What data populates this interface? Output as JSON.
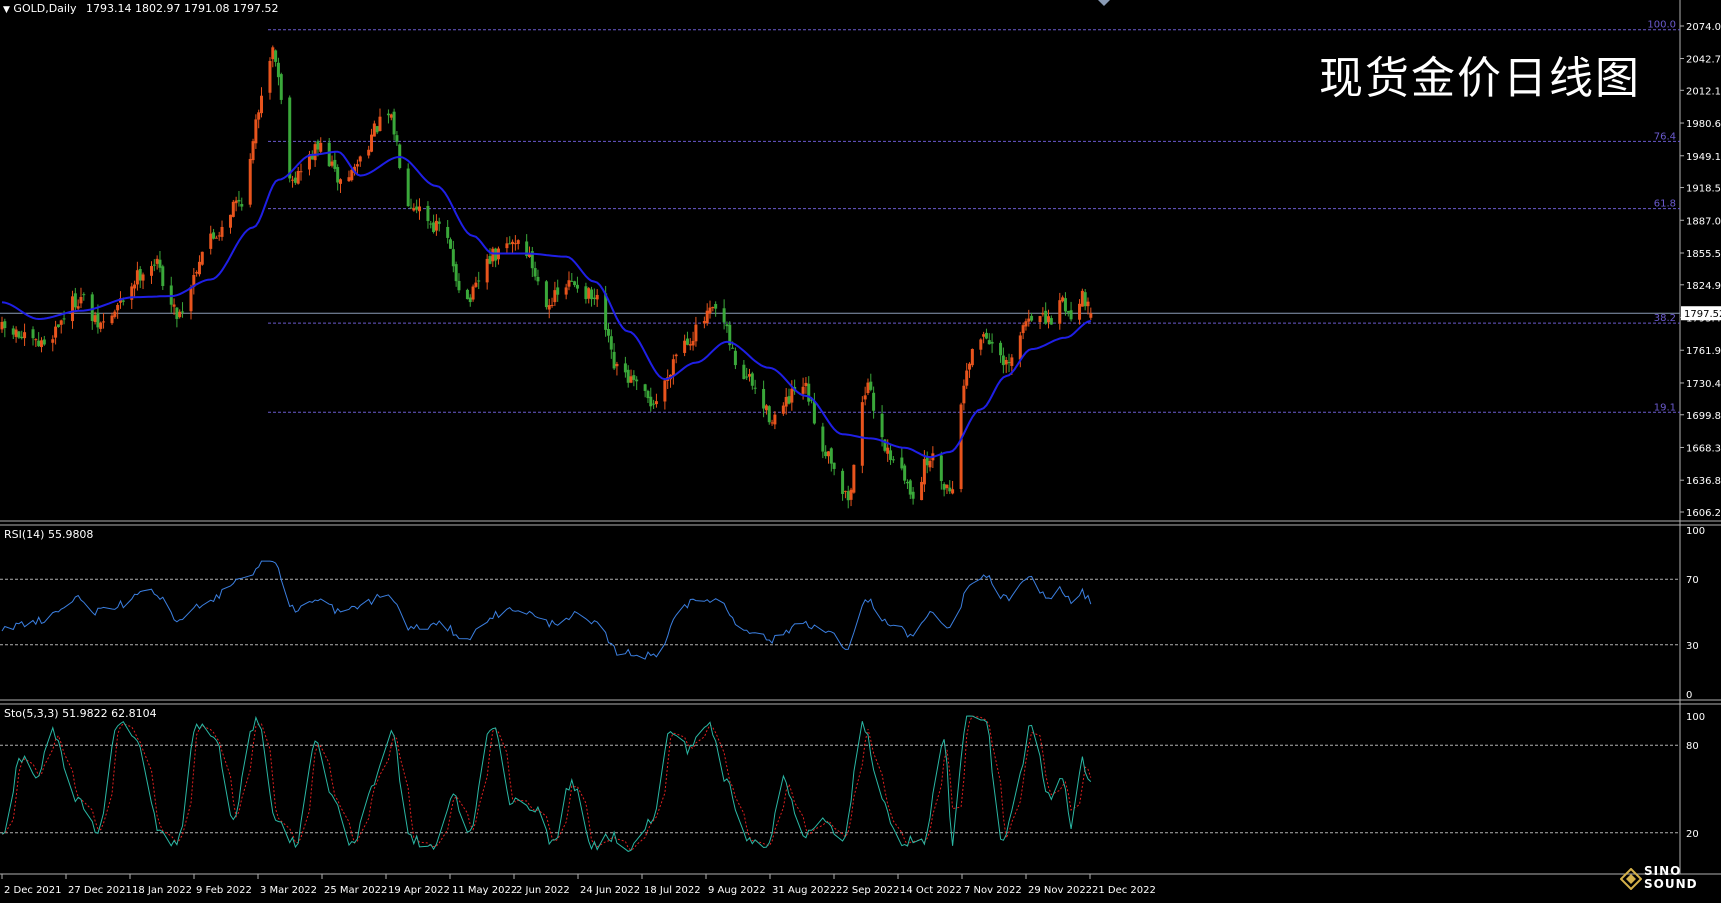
{
  "window": {
    "symbol_label": "GOLD,Daily",
    "ohlc": "1793.14 1802.97 1791.08 1797.52",
    "dropdown_icon": "triangle-down-icon"
  },
  "overlay_title": "现货金价日线图",
  "colors": {
    "background": "#000000",
    "bull": "#e8541d",
    "bear": "#3aa83a",
    "ma": "#1f1fe6",
    "rsi": "#3b7fe0",
    "stoch_main": "#2ab7a4",
    "stoch_signal": "#e02020",
    "fib": "#6a5acd",
    "grid": "#b0b0b0",
    "price_line": "#8a9bb5",
    "axis_text": "#ffffff"
  },
  "chart_data": [
    {
      "type": "candlestick",
      "title": "GOLD,Daily",
      "symbol": "GOLD",
      "timeframe": "Daily",
      "ohlc_last": {
        "open": 1793.14,
        "high": 1802.97,
        "low": 1791.08,
        "close": 1797.52
      },
      "ylim": [
        1606.2,
        2074.0
      ],
      "y_ticks": [
        "2074.00",
        "2042.70",
        "2012.10",
        "1980.60",
        "1949.10",
        "1918.50",
        "1887.00",
        "1855.50",
        "1824.90",
        "1793.40",
        "1761.90",
        "1730.40",
        "1699.80",
        "1668.30",
        "1636.80",
        "1606.20"
      ],
      "current_price_label": "1797.52",
      "x_ticks": [
        "2 Dec 2021",
        "27 Dec 2021",
        "18 Jan 2022",
        "9 Feb 2022",
        "3 Mar 2022",
        "25 Mar 2022",
        "19 Apr 2022",
        "11 May 2022",
        "2 Jun 2022",
        "24 Jun 2022",
        "18 Jul 2022",
        "9 Aug 2022",
        "31 Aug 2022",
        "22 Sep 2022",
        "14 Oct 2022",
        "7 Nov 2022",
        "29 Nov 2022",
        "21 Dec 2022"
      ],
      "fibonacci": [
        {
          "label": "100.0",
          "price": 2070.4
        },
        {
          "label": "76.4",
          "price": 1963.0
        },
        {
          "label": "61.8",
          "price": 1898.2
        },
        {
          "label": "38.2",
          "price": 1788.0
        },
        {
          "label": "19.1",
          "price": 1702.2
        }
      ],
      "moving_average_anchors": [
        {
          "date": "2021-12-02",
          "value": 1808
        },
        {
          "date": "2021-12-15",
          "value": 1792
        },
        {
          "date": "2021-12-30",
          "value": 1800
        },
        {
          "date": "2022-01-18",
          "value": 1813
        },
        {
          "date": "2022-01-31",
          "value": 1814
        },
        {
          "date": "2022-02-14",
          "value": 1830
        },
        {
          "date": "2022-03-01",
          "value": 1880
        },
        {
          "date": "2022-03-10",
          "value": 1926
        },
        {
          "date": "2022-03-22",
          "value": 1950
        },
        {
          "date": "2022-03-31",
          "value": 1953
        },
        {
          "date": "2022-04-08",
          "value": 1930
        },
        {
          "date": "2022-04-22",
          "value": 1948
        },
        {
          "date": "2022-05-05",
          "value": 1920
        },
        {
          "date": "2022-05-18",
          "value": 1872
        },
        {
          "date": "2022-05-25",
          "value": 1855
        },
        {
          "date": "2022-06-06",
          "value": 1855
        },
        {
          "date": "2022-06-20",
          "value": 1852
        },
        {
          "date": "2022-06-30",
          "value": 1828
        },
        {
          "date": "2022-07-12",
          "value": 1780
        },
        {
          "date": "2022-07-25",
          "value": 1734
        },
        {
          "date": "2022-08-05",
          "value": 1750
        },
        {
          "date": "2022-08-16",
          "value": 1770
        },
        {
          "date": "2022-08-31",
          "value": 1745
        },
        {
          "date": "2022-09-13",
          "value": 1718
        },
        {
          "date": "2022-09-26",
          "value": 1681
        },
        {
          "date": "2022-10-06",
          "value": 1677
        },
        {
          "date": "2022-10-18",
          "value": 1668
        },
        {
          "date": "2022-10-27",
          "value": 1659
        },
        {
          "date": "2022-11-03",
          "value": 1664
        },
        {
          "date": "2022-11-14",
          "value": 1705
        },
        {
          "date": "2022-11-23",
          "value": 1737
        },
        {
          "date": "2022-12-02",
          "value": 1763
        },
        {
          "date": "2022-12-14",
          "value": 1774
        },
        {
          "date": "2022-12-23",
          "value": 1790
        }
      ],
      "close_anchors": [
        {
          "date": "2021-12-02",
          "value": 1782
        },
        {
          "date": "2021-12-15",
          "value": 1767
        },
        {
          "date": "2021-12-30",
          "value": 1812
        },
        {
          "date": "2022-01-05",
          "value": 1786
        },
        {
          "date": "2022-01-25",
          "value": 1846
        },
        {
          "date": "2022-02-02",
          "value": 1798
        },
        {
          "date": "2022-02-14",
          "value": 1870
        },
        {
          "date": "2022-02-24",
          "value": 1905
        },
        {
          "date": "2022-03-08",
          "value": 2050
        },
        {
          "date": "2022-03-15",
          "value": 1928
        },
        {
          "date": "2022-03-25",
          "value": 1957
        },
        {
          "date": "2022-04-01",
          "value": 1925
        },
        {
          "date": "2022-04-18",
          "value": 1985
        },
        {
          "date": "2022-04-26",
          "value": 1905
        },
        {
          "date": "2022-05-06",
          "value": 1880
        },
        {
          "date": "2022-05-16",
          "value": 1810
        },
        {
          "date": "2022-05-25",
          "value": 1852
        },
        {
          "date": "2022-06-03",
          "value": 1868
        },
        {
          "date": "2022-06-14",
          "value": 1810
        },
        {
          "date": "2022-06-23",
          "value": 1827
        },
        {
          "date": "2022-07-01",
          "value": 1808
        },
        {
          "date": "2022-07-08",
          "value": 1742
        },
        {
          "date": "2022-07-21",
          "value": 1712
        },
        {
          "date": "2022-08-01",
          "value": 1772
        },
        {
          "date": "2022-08-12",
          "value": 1799
        },
        {
          "date": "2022-08-22",
          "value": 1737
        },
        {
          "date": "2022-09-01",
          "value": 1698
        },
        {
          "date": "2022-09-12",
          "value": 1725
        },
        {
          "date": "2022-09-20",
          "value": 1666
        },
        {
          "date": "2022-09-28",
          "value": 1620
        },
        {
          "date": "2022-10-04",
          "value": 1725
        },
        {
          "date": "2022-10-13",
          "value": 1662
        },
        {
          "date": "2022-10-21",
          "value": 1625
        },
        {
          "date": "2022-10-27",
          "value": 1658
        },
        {
          "date": "2022-11-03",
          "value": 1629
        },
        {
          "date": "2022-11-10",
          "value": 1755
        },
        {
          "date": "2022-11-15",
          "value": 1778
        },
        {
          "date": "2022-11-23",
          "value": 1745
        },
        {
          "date": "2022-12-02",
          "value": 1797
        },
        {
          "date": "2022-12-08",
          "value": 1788
        },
        {
          "date": "2022-12-13",
          "value": 1810
        },
        {
          "date": "2022-12-16",
          "value": 1793
        },
        {
          "date": "2022-12-20",
          "value": 1817
        },
        {
          "date": "2022-12-23",
          "value": 1797.52
        }
      ]
    },
    {
      "type": "line",
      "title": "RSI(14) 55.9808",
      "ylim": [
        0,
        100
      ],
      "y_ticks": [
        "100",
        "70",
        "30",
        "0"
      ],
      "levels": [
        70,
        30
      ],
      "anchors": [
        {
          "date": "2021-12-02",
          "value": 40
        },
        {
          "date": "2021-12-15",
          "value": 45
        },
        {
          "date": "2021-12-30",
          "value": 58
        },
        {
          "date": "2022-01-05",
          "value": 50
        },
        {
          "date": "2022-01-25",
          "value": 62
        },
        {
          "date": "2022-02-02",
          "value": 45
        },
        {
          "date": "2022-02-14",
          "value": 58
        },
        {
          "date": "2022-02-24",
          "value": 70
        },
        {
          "date": "2022-03-08",
          "value": 82
        },
        {
          "date": "2022-03-15",
          "value": 52
        },
        {
          "date": "2022-03-25",
          "value": 57
        },
        {
          "date": "2022-04-01",
          "value": 50
        },
        {
          "date": "2022-04-18",
          "value": 60
        },
        {
          "date": "2022-04-26",
          "value": 40
        },
        {
          "date": "2022-05-06",
          "value": 42
        },
        {
          "date": "2022-05-16",
          "value": 34
        },
        {
          "date": "2022-05-25",
          "value": 48
        },
        {
          "date": "2022-06-03",
          "value": 52
        },
        {
          "date": "2022-06-14",
          "value": 43
        },
        {
          "date": "2022-06-23",
          "value": 48
        },
        {
          "date": "2022-07-01",
          "value": 42
        },
        {
          "date": "2022-07-08",
          "value": 26
        },
        {
          "date": "2022-07-21",
          "value": 23
        },
        {
          "date": "2022-08-01",
          "value": 55
        },
        {
          "date": "2022-08-12",
          "value": 58
        },
        {
          "date": "2022-08-22",
          "value": 40
        },
        {
          "date": "2022-09-01",
          "value": 33
        },
        {
          "date": "2022-09-12",
          "value": 44
        },
        {
          "date": "2022-09-20",
          "value": 38
        },
        {
          "date": "2022-09-28",
          "value": 28
        },
        {
          "date": "2022-10-04",
          "value": 58
        },
        {
          "date": "2022-10-13",
          "value": 42
        },
        {
          "date": "2022-10-21",
          "value": 36
        },
        {
          "date": "2022-10-27",
          "value": 48
        },
        {
          "date": "2022-11-03",
          "value": 40
        },
        {
          "date": "2022-11-10",
          "value": 65
        },
        {
          "date": "2022-11-15",
          "value": 72
        },
        {
          "date": "2022-11-23",
          "value": 58
        },
        {
          "date": "2022-12-02",
          "value": 70
        },
        {
          "date": "2022-12-08",
          "value": 58
        },
        {
          "date": "2022-12-13",
          "value": 64
        },
        {
          "date": "2022-12-16",
          "value": 55
        },
        {
          "date": "2022-12-20",
          "value": 62
        },
        {
          "date": "2022-12-23",
          "value": 55.98
        }
      ]
    },
    {
      "type": "line",
      "title": "Sto(5,3,3) 51.9822 62.8104",
      "ylim": [
        0,
        100
      ],
      "y_ticks": [
        "100",
        "80",
        "20"
      ],
      "levels": [
        80,
        20
      ],
      "series": [
        {
          "name": "main",
          "last": 51.9822
        },
        {
          "name": "signal",
          "last": 62.8104
        }
      ],
      "anchors": [
        {
          "date": "2021-12-02",
          "value": 18
        },
        {
          "date": "2021-12-09",
          "value": 72
        },
        {
          "date": "2021-12-14",
          "value": 55
        },
        {
          "date": "2021-12-20",
          "value": 90
        },
        {
          "date": "2021-12-28",
          "value": 45
        },
        {
          "date": "2022-01-05",
          "value": 22
        },
        {
          "date": "2022-01-12",
          "value": 95
        },
        {
          "date": "2022-01-19",
          "value": 82
        },
        {
          "date": "2022-01-27",
          "value": 20
        },
        {
          "date": "2022-02-02",
          "value": 12
        },
        {
          "date": "2022-02-09",
          "value": 95
        },
        {
          "date": "2022-02-16",
          "value": 82
        },
        {
          "date": "2022-02-22",
          "value": 30
        },
        {
          "date": "2022-02-28",
          "value": 88
        },
        {
          "date": "2022-03-03",
          "value": 98
        },
        {
          "date": "2022-03-09",
          "value": 28
        },
        {
          "date": "2022-03-16",
          "value": 12
        },
        {
          "date": "2022-03-23",
          "value": 82
        },
        {
          "date": "2022-03-30",
          "value": 42
        },
        {
          "date": "2022-04-05",
          "value": 10
        },
        {
          "date": "2022-04-12",
          "value": 52
        },
        {
          "date": "2022-04-19",
          "value": 88
        },
        {
          "date": "2022-04-26",
          "value": 15
        },
        {
          "date": "2022-05-04",
          "value": 10
        },
        {
          "date": "2022-05-11",
          "value": 45
        },
        {
          "date": "2022-05-16",
          "value": 18
        },
        {
          "date": "2022-05-25",
          "value": 95
        },
        {
          "date": "2022-06-01",
          "value": 40
        },
        {
          "date": "2022-06-09",
          "value": 38
        },
        {
          "date": "2022-06-15",
          "value": 12
        },
        {
          "date": "2022-06-22",
          "value": 55
        },
        {
          "date": "2022-06-29",
          "value": 10
        },
        {
          "date": "2022-07-06",
          "value": 18
        },
        {
          "date": "2022-07-13",
          "value": 10
        },
        {
          "date": "2022-07-21",
          "value": 30
        },
        {
          "date": "2022-07-27",
          "value": 90
        },
        {
          "date": "2022-08-02",
          "value": 78
        },
        {
          "date": "2022-08-09",
          "value": 95
        },
        {
          "date": "2022-08-16",
          "value": 55
        },
        {
          "date": "2022-08-22",
          "value": 18
        },
        {
          "date": "2022-08-30",
          "value": 12
        },
        {
          "date": "2022-09-05",
          "value": 55
        },
        {
          "date": "2022-09-12",
          "value": 20
        },
        {
          "date": "2022-09-19",
          "value": 28
        },
        {
          "date": "2022-09-26",
          "value": 12
        },
        {
          "date": "2022-10-03",
          "value": 95
        },
        {
          "date": "2022-10-10",
          "value": 40
        },
        {
          "date": "2022-10-17",
          "value": 15
        },
        {
          "date": "2022-10-24",
          "value": 12
        },
        {
          "date": "2022-11-01",
          "value": 82
        },
        {
          "date": "2022-11-04",
          "value": 15
        },
        {
          "date": "2022-11-09",
          "value": 98
        },
        {
          "date": "2022-11-15",
          "value": 100
        },
        {
          "date": "2022-11-22",
          "value": 12
        },
        {
          "date": "2022-11-28",
          "value": 60
        },
        {
          "date": "2022-12-02",
          "value": 95
        },
        {
          "date": "2022-12-08",
          "value": 45
        },
        {
          "date": "2022-12-13",
          "value": 60
        },
        {
          "date": "2022-12-16",
          "value": 25
        },
        {
          "date": "2022-12-20",
          "value": 70
        },
        {
          "date": "2022-12-23",
          "value": 51.98
        }
      ]
    }
  ]
}
